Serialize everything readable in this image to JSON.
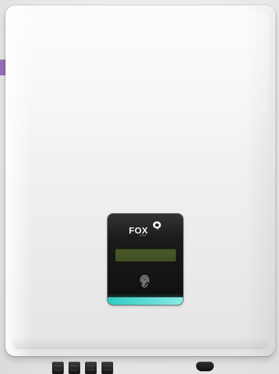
{
  "device": {
    "brand_name": "FOX",
    "brand_subtitle": "ESS",
    "logo_icon": "fox-ess-logo-mark",
    "touch_icon": "fingerprint-touch-icon",
    "status_color": "#5fd8d2",
    "lcd_color": "#4a5b28",
    "accent_color": "#9272b6"
  }
}
